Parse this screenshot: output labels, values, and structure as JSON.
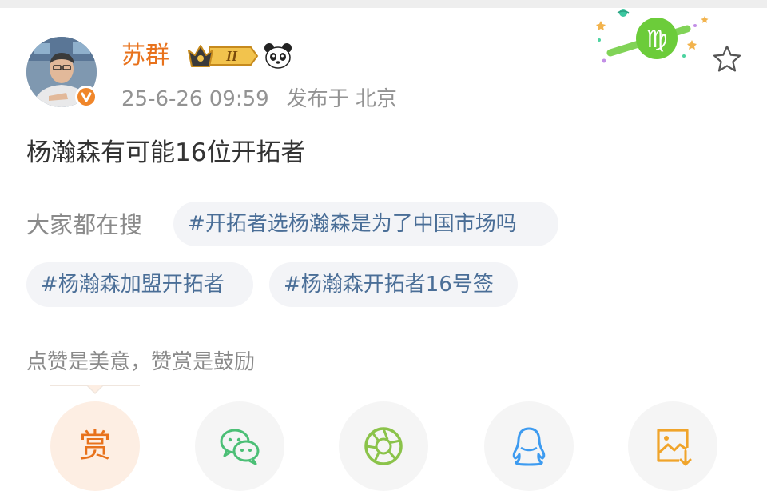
{
  "user": {
    "name": "苏群",
    "level_badge": "II",
    "verified_icon": "verified-v-icon",
    "post_date": "25-6-26 09:59",
    "location": "发布于 北京"
  },
  "post": {
    "text": "杨瀚森有可能16位开拓者"
  },
  "search": {
    "label": "大家都在搜",
    "topics": [
      "#开拓者选杨瀚森是为了中国市场吗",
      "#杨瀚森加盟开拓者",
      "#杨瀚森开拓者16号签"
    ]
  },
  "reward": {
    "note": "点赞是美意，赞赏是鼓励",
    "button_label": "赏"
  },
  "share": {
    "icons": [
      "wechat-icon",
      "moments-icon",
      "qq-icon",
      "save-image-icon"
    ]
  },
  "colors": {
    "accent_orange": "#e8721c",
    "topic_blue": "#4a6e97",
    "chip_bg": "#f3f4f7",
    "meta_gray": "#939393",
    "wechat_green": "#4cbf76",
    "moments_green": "#8bc34a",
    "qq_blue": "#3d9bf0",
    "save_orange": "#f0a42a",
    "virgo_green": "#6ccc3a"
  }
}
